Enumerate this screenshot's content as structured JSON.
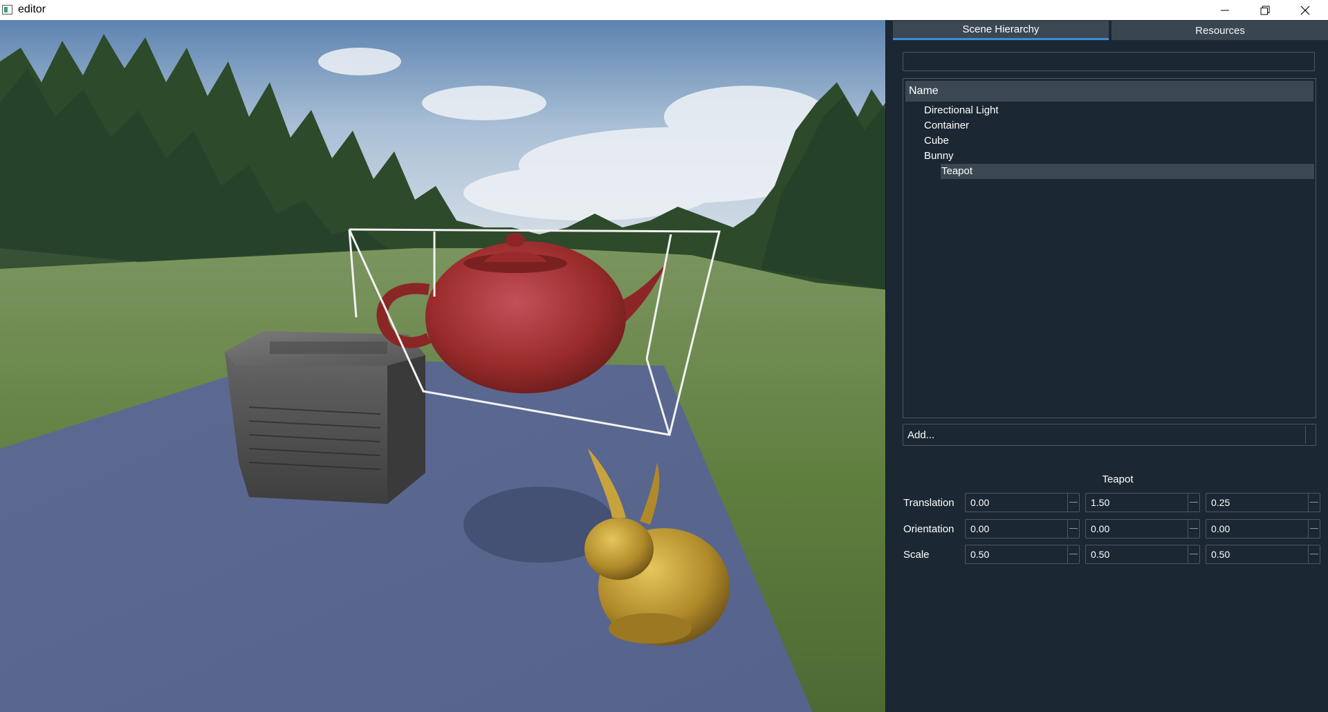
{
  "window": {
    "title": "editor"
  },
  "tabs": [
    {
      "label": "Scene Hierarchy",
      "active": true
    },
    {
      "label": "Resources",
      "active": false
    }
  ],
  "filter": {
    "value": ""
  },
  "tree": {
    "header": "Name",
    "items": [
      {
        "label": "Directional Light",
        "level": 0,
        "selected": false
      },
      {
        "label": "Container",
        "level": 0,
        "selected": false
      },
      {
        "label": "Cube",
        "level": 0,
        "selected": false
      },
      {
        "label": "Bunny",
        "level": 0,
        "selected": false
      },
      {
        "label": "Teapot",
        "level": 1,
        "selected": true
      }
    ]
  },
  "add": {
    "placeholder": "Add..."
  },
  "properties": {
    "title": "Teapot",
    "rows": [
      {
        "label": "Translation",
        "values": [
          "0.00",
          "1.50",
          "0.25"
        ]
      },
      {
        "label": "Orientation",
        "values": [
          "0.00",
          "0.00",
          "0.00"
        ]
      },
      {
        "label": "Scale",
        "values": [
          "0.50",
          "0.50",
          "0.50"
        ]
      }
    ]
  },
  "colors": {
    "panel_bg": "#1b2833",
    "accent": "#3e8ed8",
    "selection": "#3b4854"
  }
}
